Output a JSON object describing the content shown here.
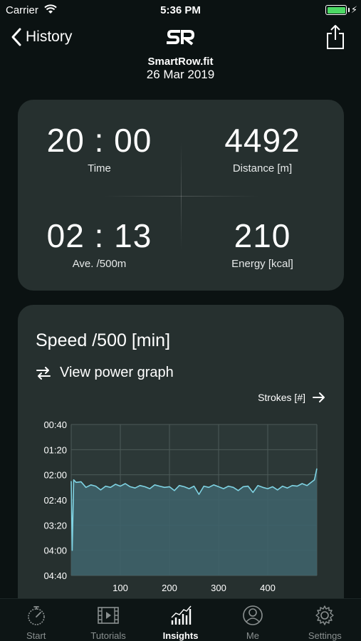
{
  "status_bar": {
    "carrier": "Carrier",
    "time": "5:36 PM"
  },
  "nav": {
    "back_label": "History",
    "brand": "SmartRow.fit",
    "date": "26 Mar 2019"
  },
  "summary": {
    "time": {
      "value": "20 : 00",
      "label": "Time"
    },
    "distance": {
      "value": "4492",
      "label": "Distance [m]"
    },
    "avg_pace": {
      "value": "02 : 13",
      "label": "Ave. /500m"
    },
    "energy": {
      "value": "210",
      "label": "Energy [kcal]"
    }
  },
  "graph": {
    "title": "Speed /500 [min]",
    "toggle_label": "View power graph",
    "x_axis_link": "Strokes [#]"
  },
  "chart_data": {
    "type": "area",
    "title": "Speed /500 [min]",
    "xlabel": "Strokes [#]",
    "ylabel": "",
    "xlim": [
      0,
      500
    ],
    "ylim_seconds": [
      40,
      280
    ],
    "y_inverted": true,
    "y_ticks": [
      "00:40",
      "01:20",
      "02:00",
      "02:40",
      "03:20",
      "04:00",
      "04:40"
    ],
    "x_ticks": [
      "100",
      "200",
      "300",
      "400"
    ],
    "grid": true,
    "series": [
      {
        "x": [
          0,
          2,
          5,
          10,
          20,
          30,
          40,
          50,
          60,
          70,
          80,
          90,
          100,
          110,
          120,
          130,
          140,
          150,
          160,
          170,
          180,
          190,
          200,
          210,
          220,
          230,
          240,
          250,
          260,
          270,
          280,
          290,
          300,
          310,
          320,
          330,
          340,
          350,
          360,
          370,
          380,
          390,
          400,
          410,
          420,
          430,
          440,
          450,
          460,
          470,
          480,
          490,
          495,
          500
        ],
        "y_seconds": [
          130,
          240,
          128,
          132,
          131,
          140,
          136,
          138,
          144,
          138,
          140,
          135,
          138,
          134,
          139,
          141,
          137,
          139,
          142,
          136,
          138,
          140,
          139,
          145,
          137,
          139,
          142,
          138,
          151,
          138,
          140,
          136,
          139,
          142,
          138,
          140,
          145,
          139,
          138,
          148,
          137,
          140,
          142,
          139,
          144,
          138,
          141,
          137,
          138,
          134,
          137,
          131,
          128,
          110
        ]
      }
    ],
    "colors": {
      "line": "#7fd3e3",
      "fill": "#3e6269"
    }
  },
  "tabs": [
    {
      "label": "Start",
      "icon": "stopwatch-icon",
      "active": false
    },
    {
      "label": "Tutorials",
      "icon": "film-icon",
      "active": false
    },
    {
      "label": "Insights",
      "icon": "bar-chart-icon",
      "active": true
    },
    {
      "label": "Me",
      "icon": "person-icon",
      "active": false
    },
    {
      "label": "Settings",
      "icon": "gear-icon",
      "active": false
    }
  ]
}
